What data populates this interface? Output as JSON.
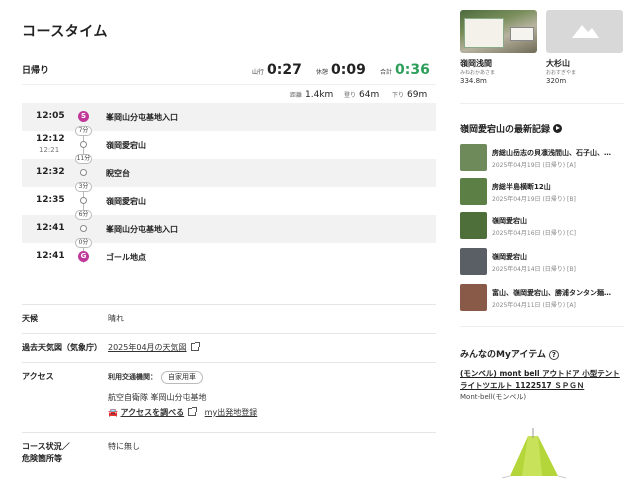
{
  "page_title": "コースタイム",
  "summary": {
    "day": "日帰り",
    "walk_label": "山行",
    "walk_val": "0:27",
    "rest_label": "休憩",
    "rest_val": "0:09",
    "total_label": "合計",
    "total_val": "0:36",
    "dist_label": "距離",
    "dist_val": "1.4km",
    "up_label": "登り",
    "up_val": "64m",
    "down_label": "下り",
    "down_val": "69m"
  },
  "timeline": [
    {
      "time": "12:05",
      "time2": "",
      "mark": "S",
      "place": "峯岡山分屯基地入口"
    },
    {
      "time": "12:12",
      "time2": "12:21",
      "mark": "",
      "place": "嶺岡愛宕山"
    },
    {
      "time": "12:32",
      "time2": "",
      "mark": "",
      "place": "睨空台"
    },
    {
      "time": "12:35",
      "time2": "",
      "mark": "",
      "place": "嶺岡愛宕山"
    },
    {
      "time": "12:41",
      "time2": "",
      "mark": "",
      "place": "峯岡山分屯基地入口"
    },
    {
      "time": "12:41",
      "time2": "",
      "mark": "G",
      "place": "ゴール地点"
    }
  ],
  "durations": [
    "7分",
    "11分",
    "3分",
    "6分",
    "0分"
  ],
  "info": {
    "weather_label": "天候",
    "weather_val": "晴れ",
    "past_label": "過去天気図（気象庁）",
    "past_link": "2025年04月の天気図",
    "access_label": "アクセス",
    "transport_label": "利用交通機関：",
    "transport_chip": "自家用車",
    "parking": "航空自衛隊 峯岡山分屯基地",
    "access_link": "アクセスを調べる",
    "my_link": "my出発地登録",
    "course_label1": "コース状況／",
    "course_label2": "危険箇所等",
    "course_val": "特に無し"
  },
  "mountains": [
    {
      "name": "嶺岡浅間",
      "kana": "みねおかあさま",
      "alt": "334.8m"
    },
    {
      "name": "大杉山",
      "kana": "おおすぎやま",
      "alt": "320m"
    }
  ],
  "records_title": "嶺岡愛宕山の最新記録",
  "records": [
    {
      "title": "房総山岳志の貝凛浅間山、石子山、…",
      "date": "2025年04月19日 (日帰り) [A]",
      "color": "#6f8a5a"
    },
    {
      "title": "房総半島横断12山",
      "date": "2025年04月19日 (日帰り) [B]",
      "color": "#5b7f45"
    },
    {
      "title": "嶺岡愛宕山",
      "date": "2025年04月16日 (日帰り) [C]",
      "color": "#4e6e3a"
    },
    {
      "title": "嶺岡愛宕山",
      "date": "2025年04月14日 (日帰り) [B]",
      "color": "#5a5f66"
    },
    {
      "title": "富山、嶺岡愛宕山、勝浦タンタン麺…",
      "date": "2025年04月11日 (日帰り) [A]",
      "color": "#8a5a48"
    }
  ],
  "myitem_title": "みんなのMyアイテム",
  "myitem_name": "(モンベル) mont bell アウトドア 小型テント ライトツエルト 1122517 ＳＰＧＮ",
  "myitem_brand": "Mont-bell(モンベル)",
  "colors": {
    "accent_green": "#2e9e5b",
    "mark_pink": "#c0399a",
    "tent": "#b5d63a"
  }
}
